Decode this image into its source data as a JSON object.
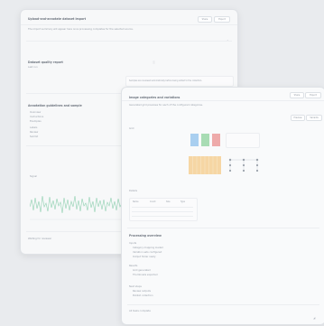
{
  "back_window": {
    "title": "Upload-and-annotate dataset import",
    "header_buttons": [
      "Share",
      "Export"
    ],
    "intro": "The import summary will appear here once processing completes for the selected source.",
    "section1_title": "Dataset quality report",
    "section1_sub": "Last run",
    "note": "Samples are reviewed automatically before being added to the collection.",
    "section2_title": "Annotation guidelines and sample",
    "bullets": [
      "Overview",
      "Instructions",
      "Examples",
      "Labels",
      "Review",
      "Submit"
    ],
    "chart_caption": "Signal",
    "footer": "Waiting for reviewer"
  },
  "front_window": {
    "title": "Image categories and variations",
    "header_buttons": [
      "Share",
      "Export"
    ],
    "subtitle": "Generated grid previews for each of the configured categories.",
    "tabs": [
      "Preview",
      "Variants"
    ],
    "grid_label": "Grid",
    "table_label": "Details",
    "table_headers": [
      "Name",
      "Count",
      "Size",
      "Type"
    ],
    "section_title": "Processing overview",
    "list1_title": "Inputs",
    "list1_items": [
      "Category mapping loaded",
      "Variation sets configured",
      "Output folder ready"
    ],
    "list2_title": "Results",
    "list2_items": [
      "Grid generated",
      "Thumbnails exported"
    ],
    "list3_title": "Next steps",
    "list3_items": [
      "Review outputs",
      "Publish collection"
    ],
    "footer": "All tasks complete",
    "accent_colors": [
      "#7fb6e8",
      "#8fd0a0",
      "#e98f8f",
      "#f2c27a"
    ]
  }
}
